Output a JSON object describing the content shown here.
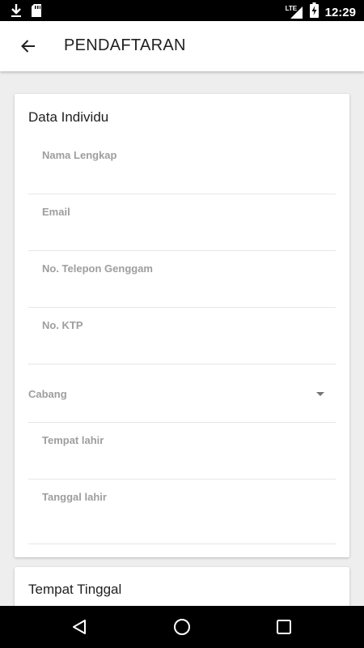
{
  "status_bar": {
    "time": "12:29",
    "network": "LTE",
    "icons": [
      "download-icon",
      "sd-card-icon",
      "signal-icon",
      "battery-charging-icon"
    ]
  },
  "app_bar": {
    "title": "PENDAFTARAN",
    "back_icon": "arrow-back-icon"
  },
  "cards": {
    "individual": {
      "title": "Data Individu",
      "fields": {
        "full_name": {
          "label": "Nama Lengkap",
          "value": ""
        },
        "email": {
          "label": "Email",
          "value": ""
        },
        "phone": {
          "label": "No. Telepon Genggam",
          "value": ""
        },
        "ktp": {
          "label": "No. KTP",
          "value": ""
        },
        "branch": {
          "label": "Cabang",
          "value": ""
        },
        "birth_place": {
          "label": "Tempat lahir",
          "value": ""
        },
        "birth_date": {
          "label": "Tanggal lahir",
          "value": ""
        }
      }
    },
    "residence": {
      "title": "Tempat Tinggal"
    }
  },
  "nav_bar": {
    "icons": [
      "back-triangle-icon",
      "home-circle-icon",
      "recents-square-icon"
    ]
  }
}
